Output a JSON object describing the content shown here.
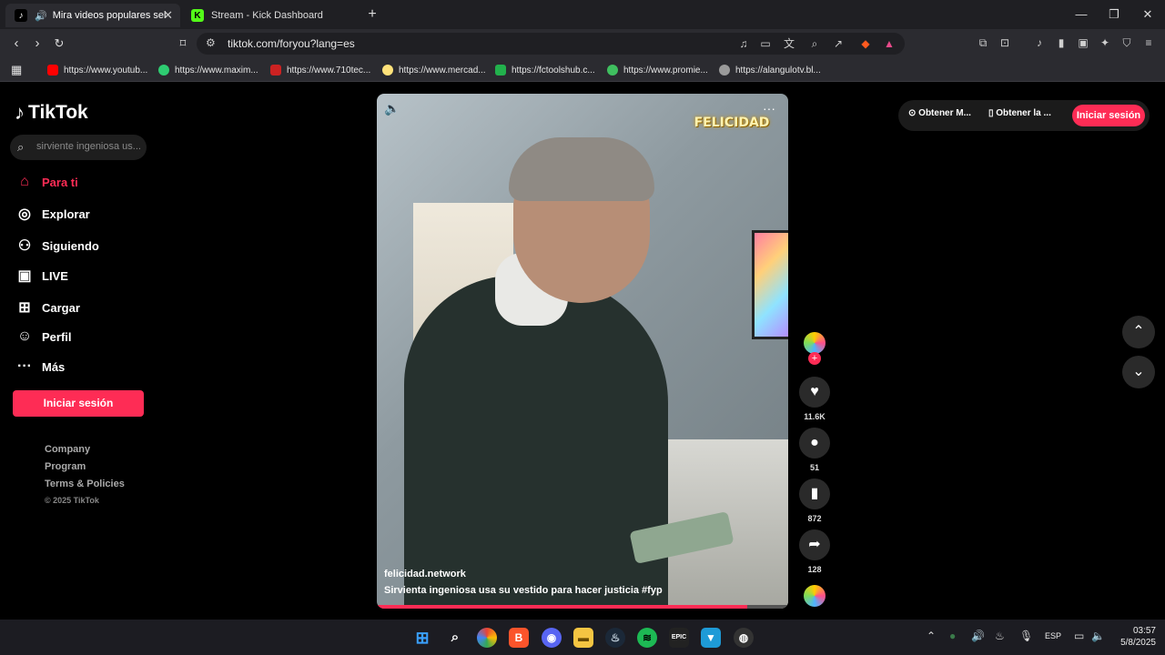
{
  "browser": {
    "tabs": [
      {
        "title": "Mira videos populares selecc",
        "favicon": "tiktok"
      },
      {
        "title": "Stream - Kick Dashboard",
        "favicon": "kick"
      }
    ],
    "new_tab": "+",
    "url": "tiktok.com/foryou?lang=es",
    "bookmarks": [
      {
        "label": "https://www.youtub...",
        "color": "#ff0000"
      },
      {
        "label": "https://www.maxim...",
        "color": "#2ecc71"
      },
      {
        "label": "https://www.710tec...",
        "color": "#cc2222"
      },
      {
        "label": "https://www.mercad...",
        "color": "#ffe27a"
      },
      {
        "label": "https://fctoolshub.c...",
        "color": "#22b14c"
      },
      {
        "label": "https://www.promie...",
        "color": "#3fbf5f"
      },
      {
        "label": "https://alangulotv.bl...",
        "color": "#9a9a9a"
      }
    ]
  },
  "tiktok": {
    "brand": "TikTok",
    "search_placeholder": "sirviente ingeniosa us...",
    "nav": [
      {
        "label": "Para ti",
        "icon": "home-icon"
      },
      {
        "label": "Explorar",
        "icon": "compass-icon"
      },
      {
        "label": "Siguiendo",
        "icon": "following-icon"
      },
      {
        "label": "LIVE",
        "icon": "live-icon"
      },
      {
        "label": "Cargar",
        "icon": "upload-icon"
      },
      {
        "label": "Perfil",
        "icon": "profile-icon"
      },
      {
        "label": "Más",
        "icon": "more-icon"
      }
    ],
    "login_button": "Iniciar sesión",
    "footer": [
      "Company",
      "Program",
      "Terms & Policies"
    ],
    "copyright": "© 2025 TikTok",
    "topbar": {
      "item1": "Obtener M...",
      "item2": "Obtener la ...",
      "login": "Iniciar sesión"
    },
    "video": {
      "badge": "FELICIDAD",
      "author": "felicidad.network",
      "caption": "Sirvienta ingeniosa usa su vestido para hacer justicia #fyp",
      "progress": 0.9
    },
    "actions": {
      "likes": "11.6K",
      "comments": "51",
      "saves": "872",
      "shares": "128"
    },
    "accent": "#fe2c55"
  },
  "system": {
    "lang": "ESP",
    "time": "03:57",
    "date": "5/8/2025"
  }
}
